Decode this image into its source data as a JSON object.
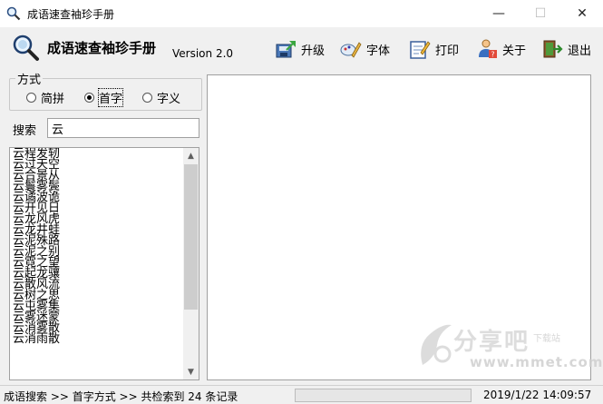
{
  "window": {
    "title": "成语速查袖珍手册",
    "controls": {
      "minimize": "—",
      "maximize": "☐",
      "close": "✕"
    }
  },
  "toolbar": {
    "app_name": "成语速查袖珍手册",
    "version": "Version 2.0",
    "buttons": [
      {
        "label": "升级",
        "icon": "upgrade-icon"
      },
      {
        "label": "字体",
        "icon": "font-icon"
      },
      {
        "label": "打印",
        "icon": "print-icon"
      },
      {
        "label": "关于",
        "icon": "about-icon"
      },
      {
        "label": "退出",
        "icon": "exit-icon"
      }
    ]
  },
  "mode": {
    "label": "方式",
    "options": [
      {
        "label": "简拼",
        "checked": false
      },
      {
        "label": "首字",
        "checked": true
      },
      {
        "label": "字义",
        "checked": false
      }
    ]
  },
  "search": {
    "label": "搜索",
    "value": "云"
  },
  "results": [
    "云程发轫",
    "云过天空",
    "云合景从",
    "云鬟雾鬓",
    "云谲波诡",
    "云开见日",
    "云龙风虎",
    "云龙井蛙",
    "云泥殊路",
    "云泥之别",
    "云霓之望",
    "云起龙骧",
    "云散风流",
    "云树之思",
    "云屯雾集",
    "云雾迷蒙",
    "云消雾散",
    "云消雨散"
  ],
  "status": {
    "text": "成语搜索 >> 首字方式 >> 共检索到 24 条记录",
    "time": "2019/1/22 14:09:57"
  },
  "watermark": {
    "main": "分享吧",
    "sub": "下载站",
    "url": "www.mmet.com"
  }
}
